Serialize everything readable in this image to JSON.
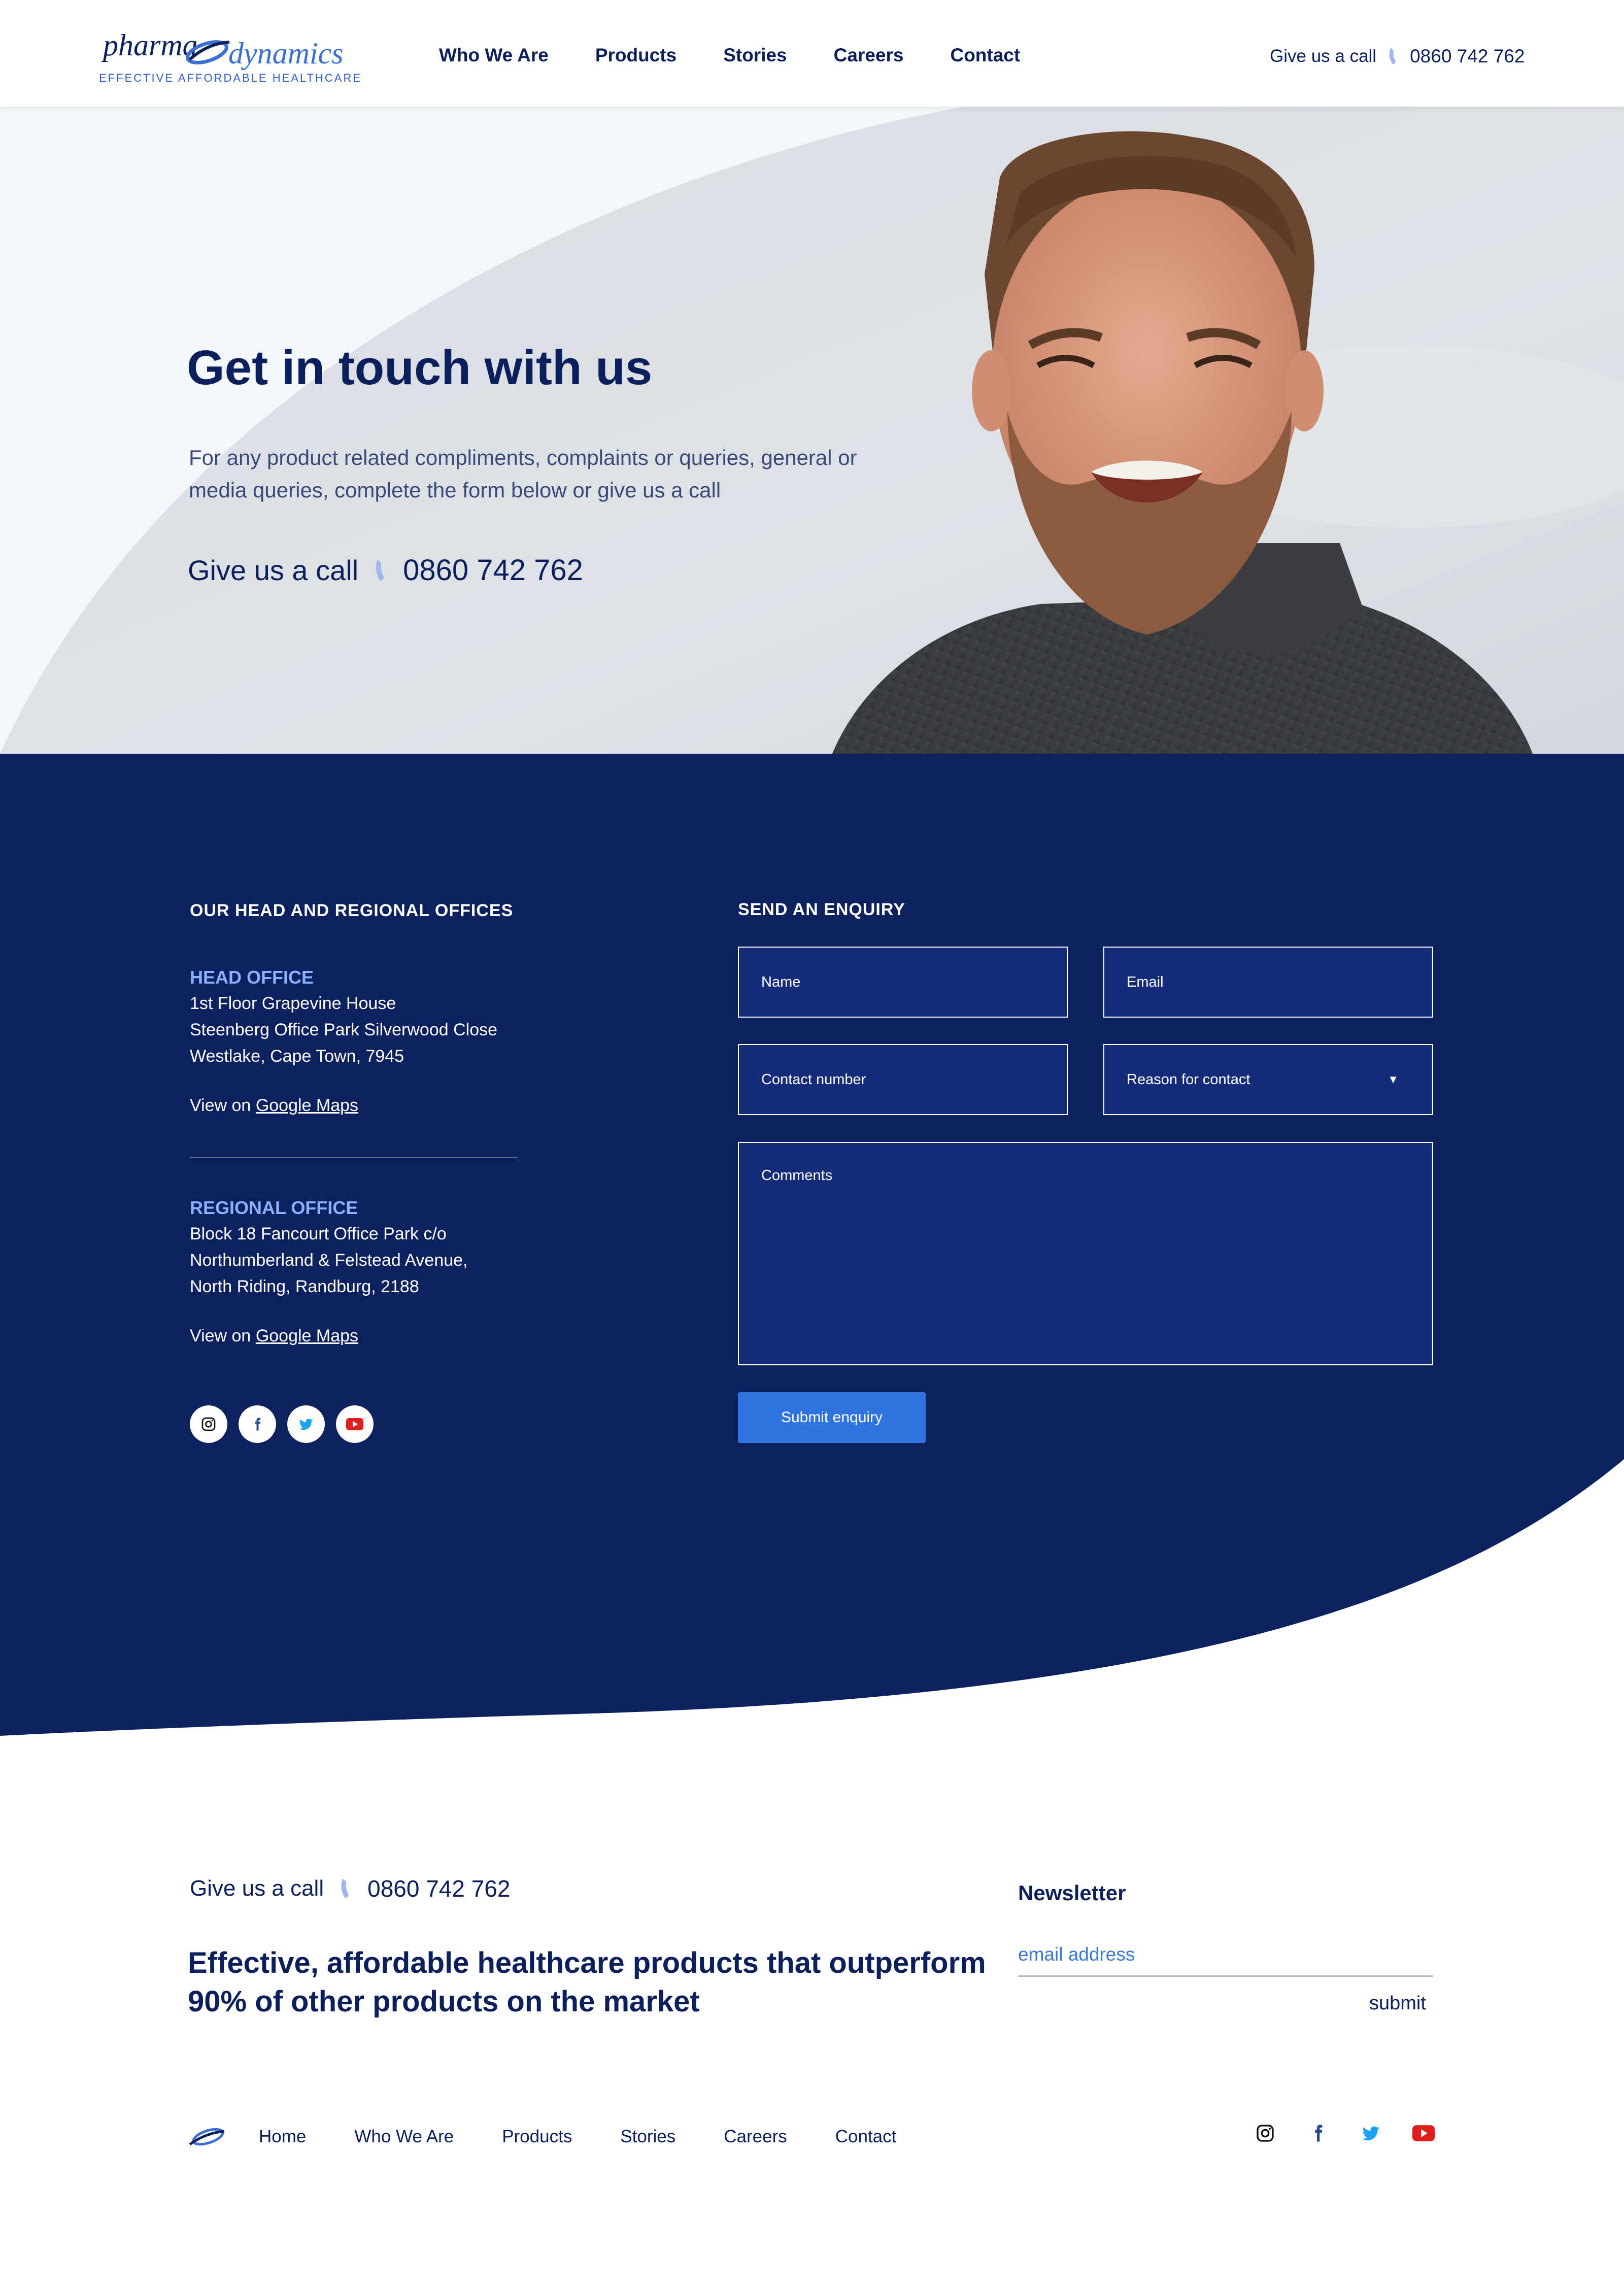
{
  "brand": {
    "logo_word_1": "pharma",
    "logo_word_2": "dynamics",
    "tagline": "EFFECTIVE AFFORDABLE HEALTHCARE",
    "colors": {
      "navy": "#0b1f5c",
      "accent_blue": "#2f73e0",
      "light_blue": "#8cb0ff",
      "form_field": "#152d78"
    }
  },
  "nav": {
    "items": [
      {
        "label": "Who We Are"
      },
      {
        "label": "Products"
      },
      {
        "label": "Stories"
      },
      {
        "label": "Careers"
      },
      {
        "label": "Contact"
      }
    ]
  },
  "header_call": {
    "label": "Give us a call",
    "number": "0860 742 762",
    "icon": "phone-icon"
  },
  "hero": {
    "title": "Get in touch with us",
    "text": "For any product related compliments, complaints or queries, general or media queries, complete the form below or give us a call",
    "call_label": "Give us a call",
    "call_number": "0860 742 762",
    "image": "smiling-bearded-man-photo"
  },
  "offices": {
    "heading": "OUR HEAD AND REGIONAL OFFICES",
    "head": {
      "title": "HEAD OFFICE",
      "lines": [
        "1st Floor Grapevine House",
        "Steenberg Office Park Silverwood Close",
        "Westlake, Cape Town, 7945"
      ],
      "map_prefix": "View on",
      "map_link": "Google Maps"
    },
    "regional": {
      "title": "REGIONAL OFFICE",
      "lines": [
        "Block 18 Fancourt Office Park c/o",
        "Northumberland & Felstead Avenue,",
        "North Riding, Randburg, 2188"
      ],
      "map_prefix": "View on",
      "map_link": "Google Maps"
    },
    "socials": [
      "instagram-icon",
      "facebook-icon",
      "twitter-icon",
      "youtube-icon"
    ]
  },
  "enquiry": {
    "heading": "SEND AN ENQUIRY",
    "name_placeholder": "Name",
    "email_placeholder": "Email",
    "contact_placeholder": "Contact number",
    "reason_placeholder": "Reason for contact",
    "comments_placeholder": "Comments",
    "submit_label": "Submit enquiry"
  },
  "footer": {
    "call_label": "Give us a call",
    "call_number": "0860 742 762",
    "tagline": "Effective, affordable healthcare products that outperform 90% of other products on the market",
    "newsletter_title": "Newsletter",
    "newsletter_placeholder": "email address",
    "newsletter_submit": "submit",
    "nav": [
      {
        "label": "Home"
      },
      {
        "label": "Who We Are"
      },
      {
        "label": "Products"
      },
      {
        "label": "Stories"
      },
      {
        "label": "Careers"
      },
      {
        "label": "Contact"
      }
    ],
    "socials": [
      "instagram-icon",
      "facebook-icon",
      "twitter-icon",
      "youtube-icon"
    ]
  }
}
